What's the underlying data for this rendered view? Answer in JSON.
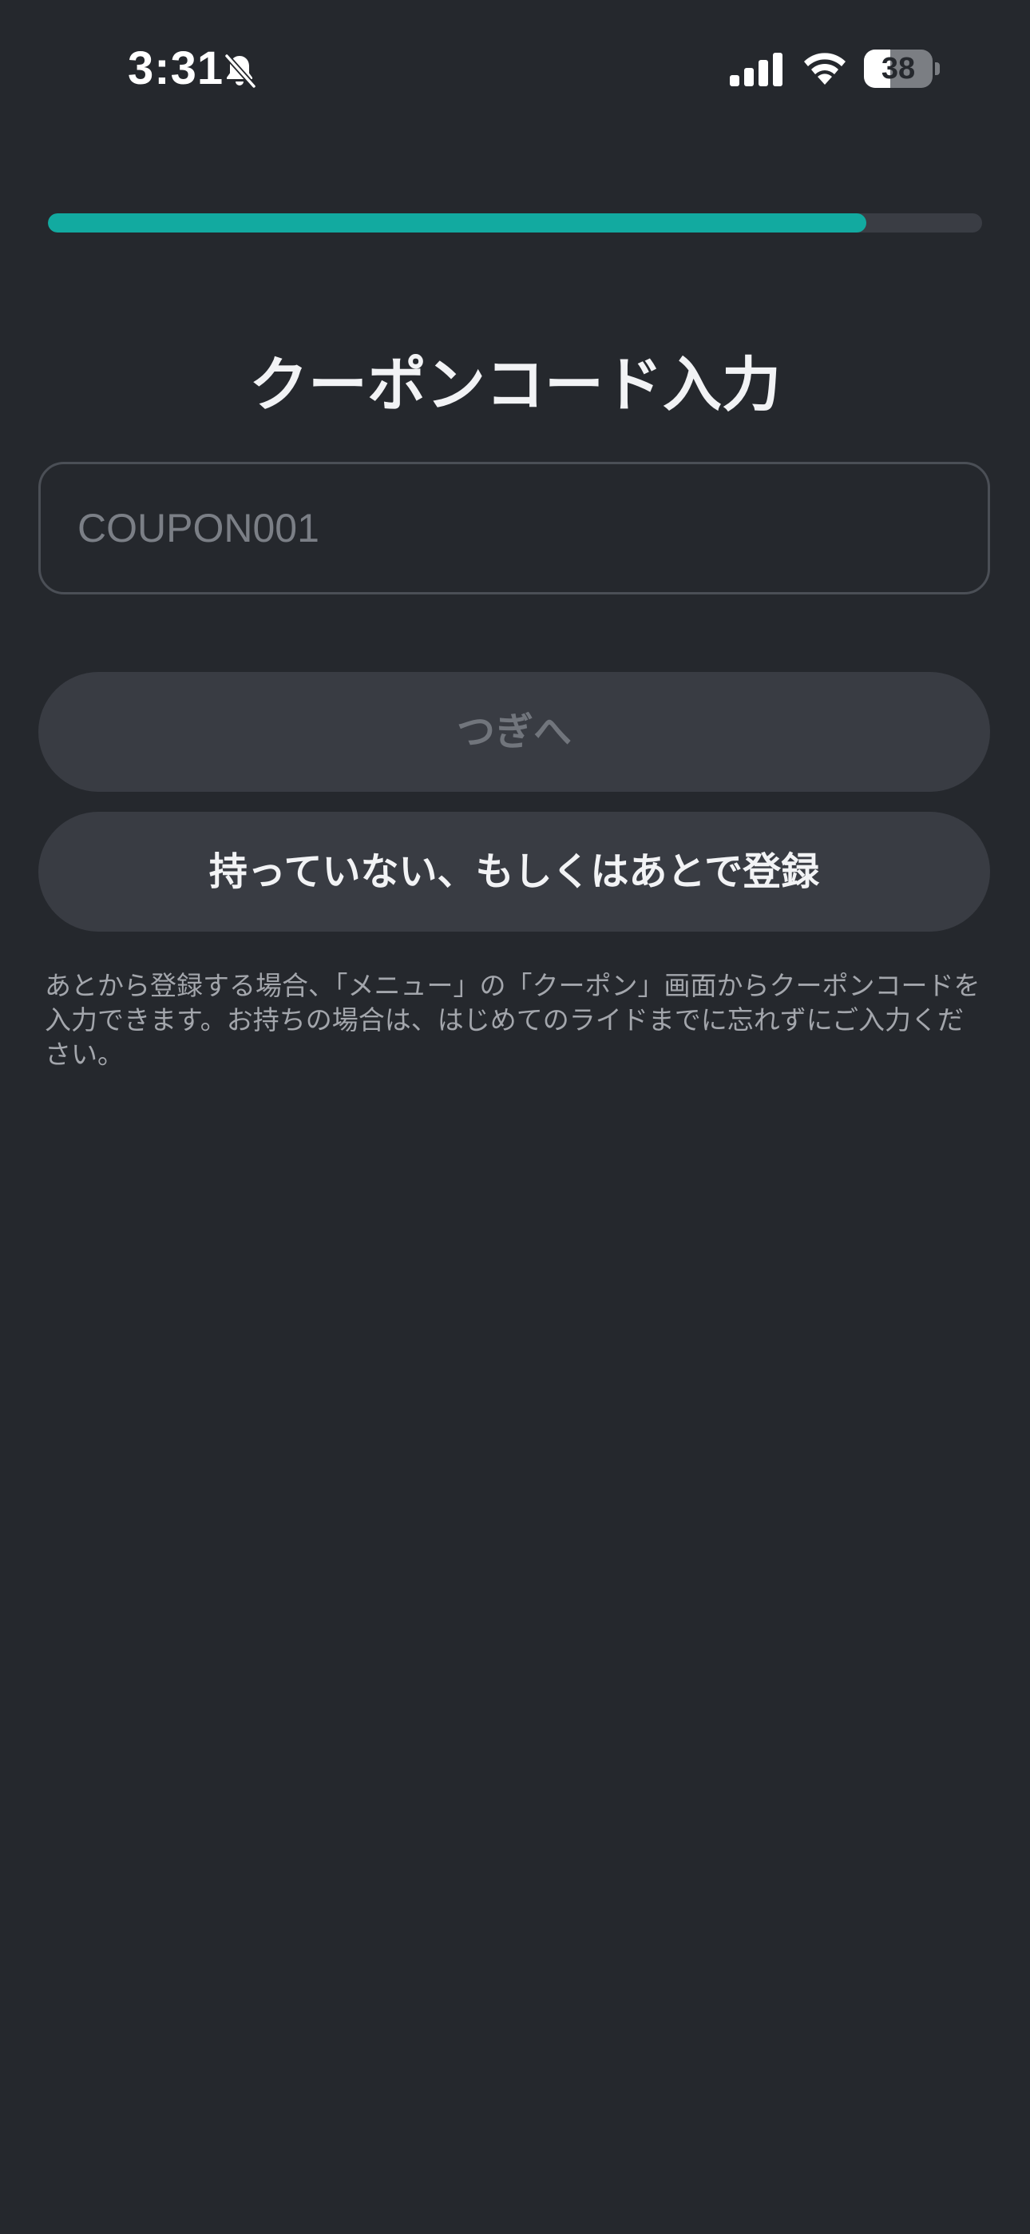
{
  "status_bar": {
    "time": "3:31",
    "battery_percent": "38",
    "battery_level": 0.38,
    "icons": [
      "bell-slash-icon",
      "cellular-signal-icon",
      "wifi-icon",
      "battery-icon"
    ]
  },
  "progress": {
    "value": 0.876
  },
  "title": "クーポンコード入力",
  "coupon_input": {
    "value": "",
    "placeholder": "COUPON001"
  },
  "buttons": {
    "next_label": "つぎへ",
    "skip_label": "持っていない、もしくはあとで登録"
  },
  "note": "あとから登録する場合、「メニュー」の「クーポン」画面からクーポンコードを入力できます。お持ちの場合は、はじめてのライドまでに忘れずにご入力ください。",
  "colors": {
    "background": "#25282d",
    "accent": "#12aaa0",
    "button_bg": "#393c43",
    "disabled_text": "#71757c"
  }
}
